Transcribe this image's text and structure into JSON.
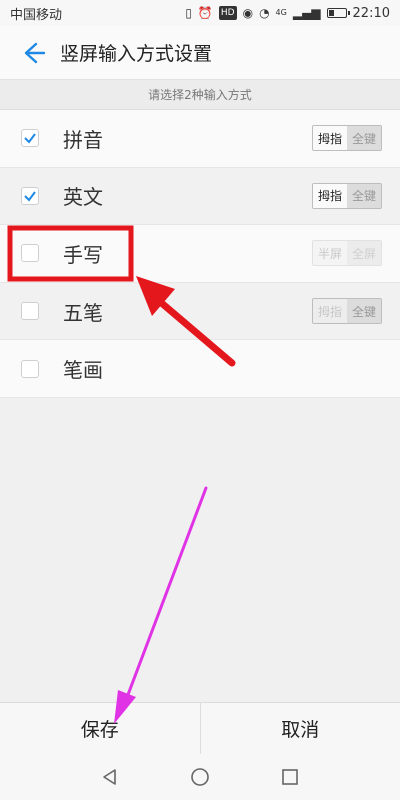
{
  "status": {
    "carrier": "中国移动",
    "hd_badge": "HD",
    "network": "4G",
    "time": "22:10",
    "battery_level": 0.35
  },
  "header": {
    "title": "竖屏输入方式设置",
    "back_icon": "arrow-left-icon"
  },
  "subtitle": "请选择2种输入方式",
  "methods": [
    {
      "label": "拼音",
      "checked": true,
      "left_option": "拇指",
      "right_option": "全键",
      "state": "enabled"
    },
    {
      "label": "英文",
      "checked": true,
      "left_option": "拇指",
      "right_option": "全键",
      "state": "enabled"
    },
    {
      "label": "手写",
      "checked": false,
      "left_option": "半屏",
      "right_option": "全屏",
      "state": "disabled"
    },
    {
      "label": "五笔",
      "checked": false,
      "left_option": "拇指",
      "right_option": "全键",
      "state": "mixed"
    },
    {
      "label": "笔画",
      "checked": false
    }
  ],
  "bottom": {
    "save": "保存",
    "cancel": "取消"
  },
  "colors": {
    "accent": "#1e88e5",
    "highlight_red": "#e4171d",
    "annotation_magenta": "#e033e6"
  }
}
